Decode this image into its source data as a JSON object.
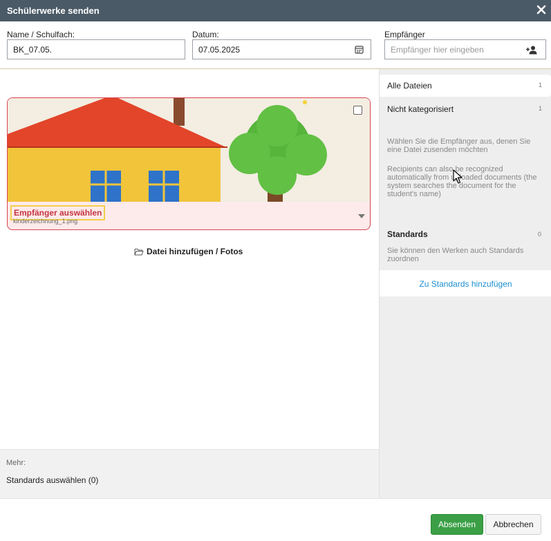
{
  "dialog": {
    "title": "Schülerwerke senden"
  },
  "form": {
    "name_label": "Name / Schulfach:",
    "name_value": "BK_07.05.",
    "date_label": "Datum:",
    "date_value": "07.05.2025",
    "recipient_label": "Empfänger",
    "recipient_placeholder": "Empfänger hier eingeben"
  },
  "file_card": {
    "select_recipient_label": "Empfänger auswählen",
    "filename": "kinderzeichnung_1.png"
  },
  "add_file_label": "Datei hinzufügen / Fotos",
  "more": {
    "label": "Mehr:",
    "standards_select": "Standards auswählen (0)"
  },
  "sidebar": {
    "items": [
      {
        "label": "Alle Dateien",
        "count": "1"
      },
      {
        "label": "Nicht kategorisiert",
        "count": "1"
      }
    ],
    "hint_1": "Wählen Sie die Empfänger aus, denen Sie eine Datei zusenden möchten",
    "hint_2": "Recipients can also be recognized automatically from uploaded documents (the system searches the document for the student's name)",
    "standards_title": "Standards",
    "standards_count": "0",
    "standards_hint": "Sie können den Werken auch Standards zuordnen",
    "add_standards_link": "Zu Standards hinzufügen"
  },
  "footer": {
    "send_label": "Absenden",
    "cancel_label": "Abbrechen"
  },
  "icons": {
    "close": "close-icon",
    "calendar": "calendar-icon",
    "add_user": "add-user-icon",
    "folder": "folder-open-icon"
  },
  "colors": {
    "titlebar": "#4a5a66",
    "card_border": "#d9414f",
    "highlight": "#f3d04a",
    "link": "#1b8fd1",
    "send_button": "#3b9f46"
  }
}
